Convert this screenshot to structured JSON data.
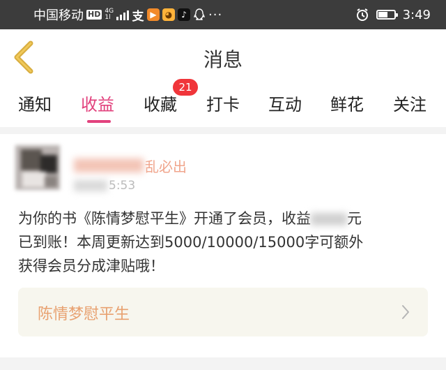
{
  "status_bar": {
    "carrier": "中国移动",
    "hd_label": "HD",
    "network_top": "4G",
    "network_bottom": "1l",
    "time": "3:49",
    "battery_level": 0.55,
    "icons": [
      "signal-icon",
      "alipay-icon",
      "video-app-icon",
      "cat-app-icon",
      "tiktok-icon",
      "qq-icon",
      "more-icon",
      "alarm-icon",
      "battery-icon"
    ]
  },
  "header": {
    "title": "消息",
    "back_icon": "back-arrow-icon"
  },
  "tabs": [
    {
      "label": "通知",
      "active": false
    },
    {
      "label": "收益",
      "active": true
    },
    {
      "label": "收藏",
      "active": false,
      "badge": "21"
    },
    {
      "label": "打卡",
      "active": false
    },
    {
      "label": "互动",
      "active": false
    },
    {
      "label": "鲜花",
      "active": false
    },
    {
      "label": "关注",
      "active": false
    }
  ],
  "message": {
    "sender_visible": "乱必出",
    "time_visible": "5:53",
    "line1_a": "为你的书《陈情梦慰平生》开通了会员，收益",
    "line1_b": "元",
    "line2": "已到账！本周更新达到5000/10000/15000字可额外",
    "line3": "获得会员分成津贴哦！",
    "book_title": "陈情梦慰平生"
  },
  "colors": {
    "accent": "#e2427d",
    "badge": "#f0353a",
    "status_bar": "#3c3c3c",
    "book_title": "#e8a170",
    "book_card_bg": "#f7f6ee"
  }
}
